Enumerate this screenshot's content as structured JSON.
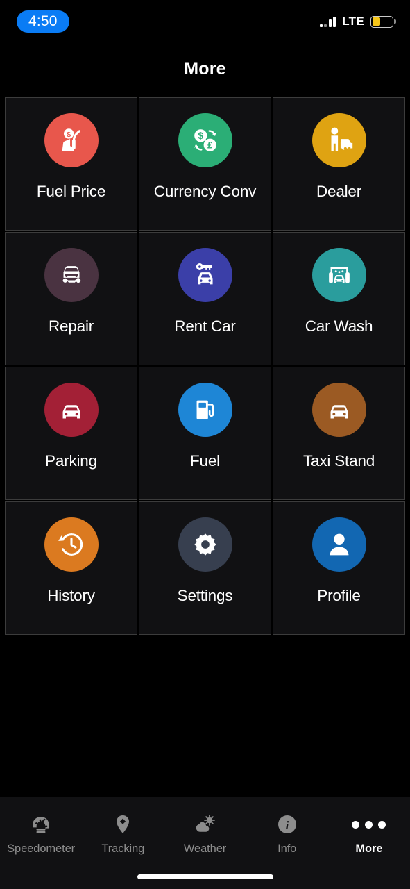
{
  "status_bar": {
    "time": "4:50",
    "time_pill_color": "#0a7cf5",
    "network_label": "LTE",
    "battery_color": "#f5c518",
    "battery_level_percent": 42,
    "signal_bars": 4,
    "signal_bars_active": 2
  },
  "header": {
    "title": "More"
  },
  "grid": {
    "tiles": [
      {
        "label": "Fuel Price",
        "icon": "fuel-price-icon",
        "color": "#e8574c"
      },
      {
        "label": "Currency Conv",
        "icon": "currency-conv-icon",
        "color": "#2bae76"
      },
      {
        "label": "Dealer",
        "icon": "dealer-icon",
        "color": "#dfa312"
      },
      {
        "label": "Repair",
        "icon": "repair-icon",
        "color": "#4a3341"
      },
      {
        "label": "Rent Car",
        "icon": "rent-car-icon",
        "color": "#3b3fa8"
      },
      {
        "label": "Car Wash",
        "icon": "car-wash-icon",
        "color": "#2a9d9d"
      },
      {
        "label": "Parking",
        "icon": "parking-icon",
        "color": "#a32036"
      },
      {
        "label": "Fuel",
        "icon": "fuel-icon",
        "color": "#1e86d6"
      },
      {
        "label": "Taxi Stand",
        "icon": "taxi-stand-icon",
        "color": "#9b5a23"
      },
      {
        "label": "History",
        "icon": "history-icon",
        "color": "#db7a20"
      },
      {
        "label": "Settings",
        "icon": "settings-icon",
        "color": "#373f4f"
      },
      {
        "label": "Profile",
        "icon": "profile-icon",
        "color": "#1267b2"
      }
    ]
  },
  "tab_bar": {
    "active": "More",
    "tabs": [
      {
        "label": "Speedometer",
        "icon": "speedometer-icon"
      },
      {
        "label": "Tracking",
        "icon": "map-pin-icon"
      },
      {
        "label": "Weather",
        "icon": "sun-cloud-icon"
      },
      {
        "label": "Info",
        "icon": "info-circle-icon"
      },
      {
        "label": "More",
        "icon": "ellipsis-icon"
      }
    ]
  }
}
